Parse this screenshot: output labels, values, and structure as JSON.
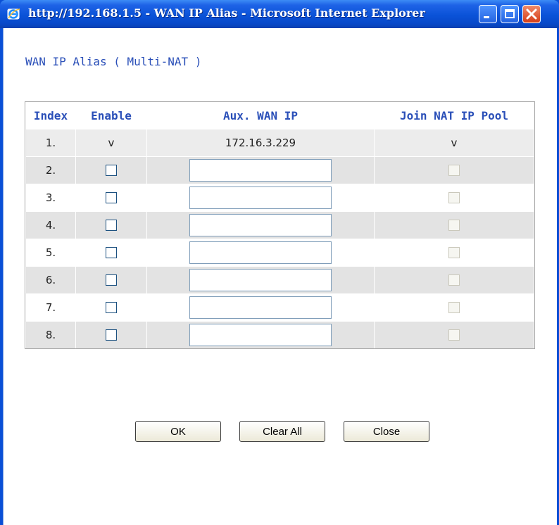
{
  "window": {
    "title": "http://192.168.1.5 - WAN IP Alias - Microsoft Internet Explorer"
  },
  "page": {
    "title": "WAN IP Alias ( Multi-NAT )"
  },
  "table": {
    "headers": {
      "index": "Index",
      "enable": "Enable",
      "aux_wan_ip": "Aux. WAN IP",
      "join_nat_ip_pool": "Join NAT IP Pool"
    },
    "rows": [
      {
        "index": "1.",
        "enable": "v",
        "aux_wan_ip": "172.16.3.229",
        "join_nat_ip_pool": "v"
      },
      {
        "index": "2.",
        "enable": false,
        "aux_wan_ip": "",
        "join_nat_ip_pool": false
      },
      {
        "index": "3.",
        "enable": false,
        "aux_wan_ip": "",
        "join_nat_ip_pool": false
      },
      {
        "index": "4.",
        "enable": false,
        "aux_wan_ip": "",
        "join_nat_ip_pool": false
      },
      {
        "index": "5.",
        "enable": false,
        "aux_wan_ip": "",
        "join_nat_ip_pool": false
      },
      {
        "index": "6.",
        "enable": false,
        "aux_wan_ip": "",
        "join_nat_ip_pool": false
      },
      {
        "index": "7.",
        "enable": false,
        "aux_wan_ip": "",
        "join_nat_ip_pool": false
      },
      {
        "index": "8.",
        "enable": false,
        "aux_wan_ip": "",
        "join_nat_ip_pool": false
      }
    ]
  },
  "buttons": {
    "ok": "OK",
    "clear_all": "Clear All",
    "close": "Close"
  },
  "icons": {
    "titlebar_app": "internet-explorer-icon",
    "minimize": "minimize-icon",
    "maximize": "maximize-icon",
    "close": "close-icon"
  },
  "colors": {
    "heading": "#2a4fb8",
    "titlebar": "#0a52d8",
    "close_button": "#d43d17"
  }
}
